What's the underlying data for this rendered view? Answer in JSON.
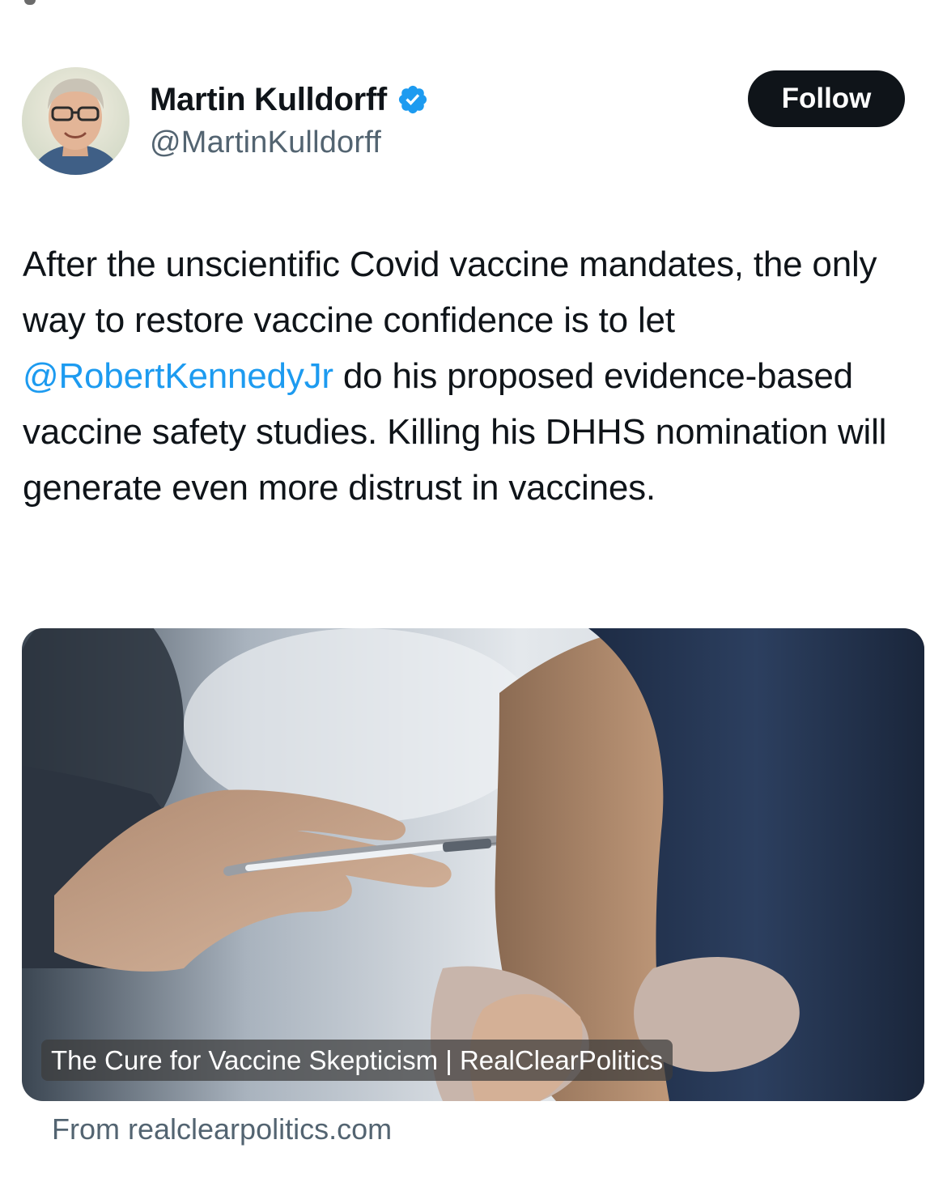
{
  "author": {
    "display_name": "Martin Kulldorff",
    "handle": "@MartinKulldorff",
    "avatar_icon": "profile-photo",
    "verified_icon": "verified-badge-icon",
    "verified_color": "#1d9bf0"
  },
  "follow_button": {
    "label": "Follow",
    "background": "#0f1419"
  },
  "tweet": {
    "text_before_mention": "After the unscientific Covid vaccine mandates, the only way to restore vaccine confidence is to let ",
    "mention": "@RobertKennedyJr",
    "text_after_mention": " do his proposed evidence-based vaccine safety studies. Killing his DHHS nomination will generate even more distrust in vaccines.",
    "mention_color": "#1d9bf0"
  },
  "link_card": {
    "caption": "The Cure for Vaccine Skepticism | RealClearPolitics",
    "source": "From realclearpolitics.com",
    "image_icon": "vaccination-photo"
  }
}
